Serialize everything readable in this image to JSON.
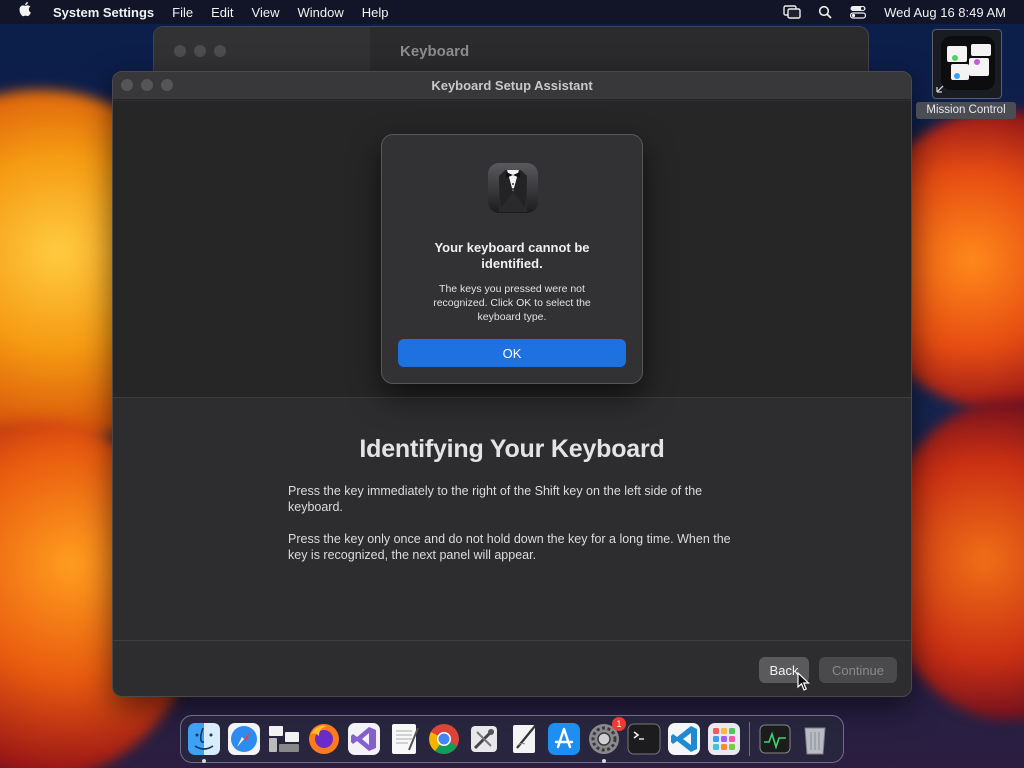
{
  "menubar": {
    "app_name": "System Settings",
    "items": [
      "File",
      "Edit",
      "View",
      "Window",
      "Help"
    ],
    "datetime": "Wed Aug 16  8:49 AM"
  },
  "background_window": {
    "title": "Keyboard"
  },
  "assistant": {
    "title": "Keyboard Setup Assistant",
    "heading": "Identifying Your Keyboard",
    "paragraph1": "Press the key immediately to the right of the Shift key on the left side of the keyboard.",
    "paragraph2": "Press the key only once and do not hold down the key for a long time. When the key is recognized, the next panel will appear.",
    "back_label": "Back",
    "continue_label": "Continue"
  },
  "alert": {
    "title": "Your keyboard cannot be identified.",
    "message": "The keys you pressed were not recognized. Click OK to select the keyboard type.",
    "ok_label": "OK"
  },
  "desktop": {
    "mission_control_label": "Mission Control"
  },
  "dock": {
    "apps": [
      {
        "name": "finder-icon",
        "running": true
      },
      {
        "name": "safari-icon",
        "running": false
      },
      {
        "name": "migration-icon",
        "running": false
      },
      {
        "name": "firefox-icon",
        "running": false
      },
      {
        "name": "visual-studio-icon",
        "running": false
      },
      {
        "name": "textedit-icon",
        "running": false
      },
      {
        "name": "chrome-icon",
        "running": false
      },
      {
        "name": "script-utility-icon",
        "running": false
      },
      {
        "name": "pen-notes-icon",
        "running": false
      },
      {
        "name": "app-store-icon",
        "running": false
      },
      {
        "name": "system-settings-icon",
        "running": true,
        "badge": "1"
      },
      {
        "name": "terminal-icon",
        "running": false
      },
      {
        "name": "vscode-icon",
        "running": false
      },
      {
        "name": "launchpad-icon",
        "running": false
      }
    ],
    "extras": [
      "activity-monitor-icon",
      "trash-icon"
    ]
  },
  "colors": {
    "accent": "#1e71e0",
    "badge": "#ee3b32"
  }
}
